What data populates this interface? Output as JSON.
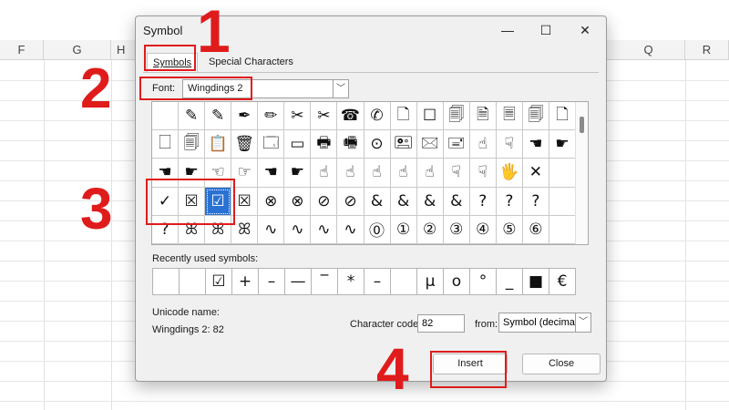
{
  "spreadsheet": {
    "columns": [
      "F",
      "G",
      "H",
      "Q",
      "R"
    ]
  },
  "dialog": {
    "title": "Symbol",
    "tabs": [
      "Symbols",
      "Special Characters"
    ],
    "font_label": "Font:",
    "font_value": "Wingdings 2",
    "symbols": [
      [
        "",
        "✎",
        "✎",
        "✒",
        "✏",
        "✂",
        "✂",
        "☎",
        "✆",
        "🗋",
        "☐",
        "🗐",
        "🗎",
        "🗏",
        "🗐",
        "🗋"
      ],
      [
        "🗌",
        "🗐",
        "📋",
        "🗑",
        "🗔",
        "▭",
        "🖶",
        "🖷",
        "⊙",
        "🖭",
        "🖂",
        "🖃",
        "☝",
        "☟",
        "☚",
        "☛"
      ],
      [
        "☚",
        "☛",
        "☜",
        "☞",
        "☚",
        "☛",
        "☝",
        "☝",
        "☝",
        "☝",
        "☝",
        "☟",
        "☟",
        "🖐",
        "✕",
        ""
      ],
      [
        "✓",
        "☒",
        "☑",
        "☒",
        "⊗",
        "⊗",
        "⊘",
        "⊘",
        "&",
        "&",
        "&",
        "&",
        "?",
        "?",
        "?",
        ""
      ],
      [
        "?",
        "ꕤ",
        "ꕤ",
        "ꕤ",
        "∿",
        "∿",
        "∿",
        "∿",
        "⓪",
        "①",
        "②",
        "③",
        "④",
        "⑤",
        "⑥",
        ""
      ]
    ],
    "recent_label": "Recently used symbols:",
    "recent": [
      "",
      "",
      "☑",
      "+",
      "–",
      "—",
      "‾",
      "*",
      "–",
      "",
      "μ",
      "o",
      "°",
      "_",
      "■",
      "€"
    ],
    "unicode_name_label": "Unicode name:",
    "unicode_name_value": "Wingdings 2: 82",
    "char_code_label": "Character code:",
    "char_code_value": "82",
    "from_label": "from:",
    "from_value": "Symbol (decimal)",
    "insert_label": "Insert",
    "close_label": "Close"
  },
  "annotations": [
    "1",
    "2",
    "3",
    "4"
  ],
  "colors": {
    "annotation": "#e01b1b",
    "selection": "#2a71d4"
  }
}
